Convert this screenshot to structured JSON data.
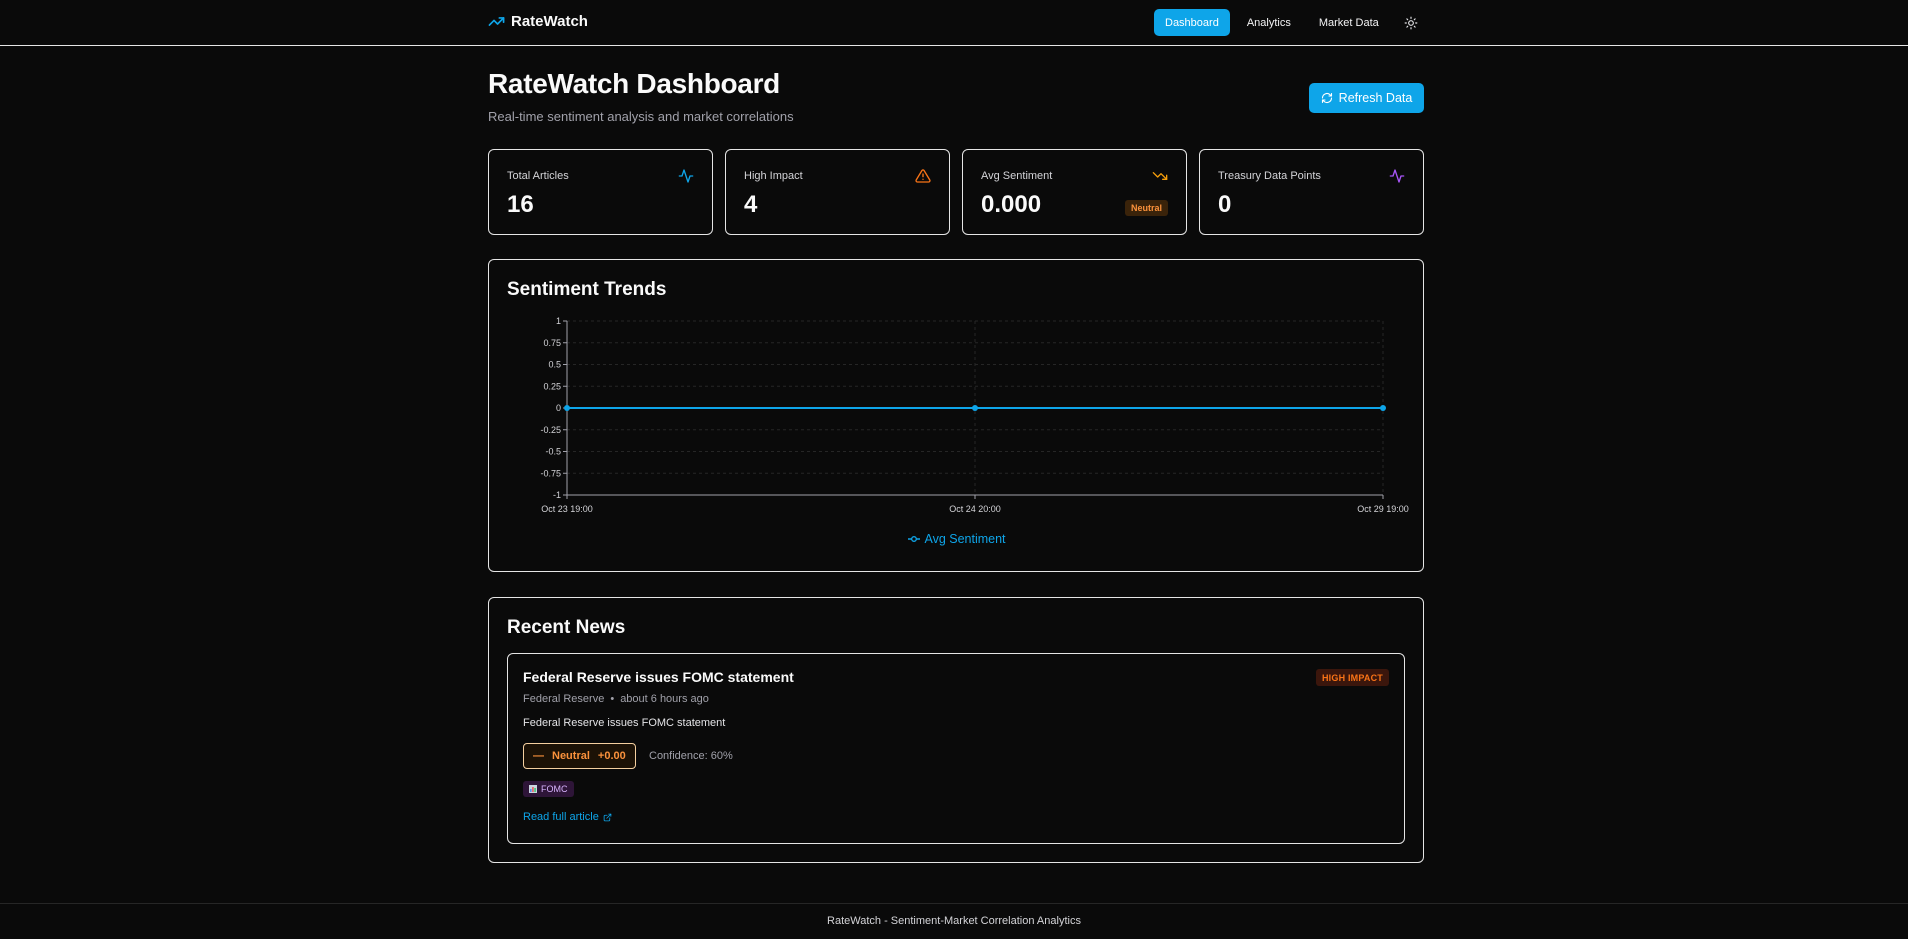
{
  "header": {
    "brand": "RateWatch",
    "brand_icon": "trending-up-icon",
    "nav": [
      {
        "label": "Dashboard",
        "active": true
      },
      {
        "label": "Analytics",
        "active": false
      },
      {
        "label": "Market Data",
        "active": false
      }
    ],
    "theme_icon": "sun-icon"
  },
  "page": {
    "title": "RateWatch Dashboard",
    "subtitle": "Real-time sentiment analysis and market correlations",
    "refresh_label": "Refresh Data"
  },
  "stats": [
    {
      "label": "Total Articles",
      "value": "16",
      "icon": "activity-icon",
      "icon_color": "#0ea5e9"
    },
    {
      "label": "High Impact",
      "value": "4",
      "icon": "alert-triangle-icon",
      "icon_color": "#f97316"
    },
    {
      "label": "Avg Sentiment",
      "value": "0.000",
      "icon": "trending-down-icon",
      "icon_color": "#f59e0b",
      "badge": "Neutral"
    },
    {
      "label": "Treasury Data Points",
      "value": "0",
      "icon": "activity-icon",
      "icon_color": "#a855f7"
    }
  ],
  "sentiment_panel": {
    "title": "Sentiment Trends"
  },
  "chart_data": {
    "type": "line",
    "x": [
      "Oct 23 19:00",
      "Oct 24 20:00",
      "Oct 29 19:00"
    ],
    "series": [
      {
        "name": "Avg Sentiment",
        "values": [
          0,
          0,
          0
        ],
        "color": "#0ea5e9"
      }
    ],
    "yticks": [
      "1",
      "0.75",
      "0.5",
      "0.25",
      "0",
      "-0.25",
      "-0.5",
      "-0.75",
      "-1"
    ],
    "ylim": [
      -1,
      1
    ],
    "grid": true,
    "legend": "bottom-center"
  },
  "news_panel": {
    "title": "Recent News",
    "items": [
      {
        "title": "Federal Reserve issues FOMC statement",
        "impact_badge": "HIGH IMPACT",
        "source": "Federal Reserve",
        "time": "about 6 hours ago",
        "summary": "Federal Reserve issues FOMC statement",
        "sentiment_label": "Neutral",
        "sentiment_score": "+0.00",
        "confidence": "Confidence: 60%",
        "tag": "FOMC",
        "link": "Read full article"
      }
    ]
  },
  "footer": {
    "text": "RateWatch - Sentiment-Market Correlation Analytics"
  }
}
